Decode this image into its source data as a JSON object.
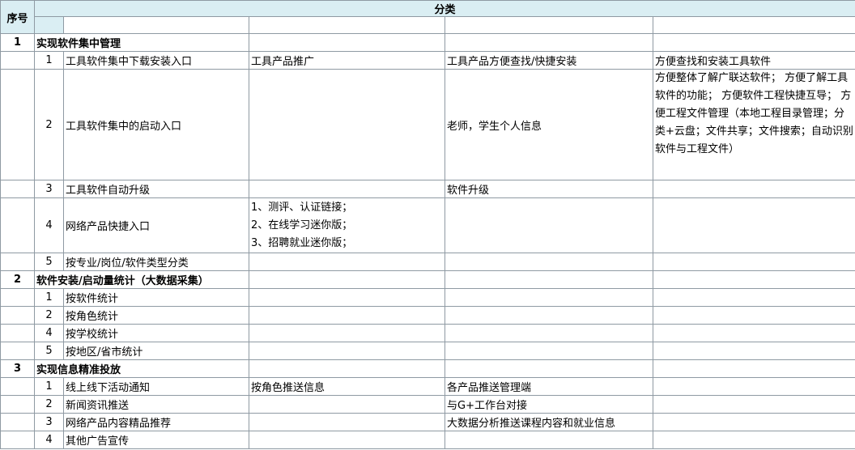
{
  "header": {
    "index_label": "序号",
    "category_label": "分类"
  },
  "sections": [
    {
      "number": "1",
      "title": "实现软件集中管理",
      "rows": [
        {
          "n": "1",
          "c1": "工具软件集中下载安装入口",
          "c2": "工具产品推广",
          "c3": "工具产品方便查找/快捷安装",
          "c4": "方便查找和安装工具软件"
        },
        {
          "n": "2",
          "c1": "工具软件集中的启动入口",
          "c2": "",
          "c3": "老师，学生个人信息",
          "c4": "方便整体了解广联达软件；\n方便了解工具软件的功能；\n方便软件工程快捷互导；\n方便工程文件管理（本地工程目录管理；分类+云盘；文件共享；文件搜索；自动识别软件与工程文件）"
        },
        {
          "n": "3",
          "c1": "工具软件自动升级",
          "c2": "",
          "c3": "软件升级",
          "c4": ""
        },
        {
          "n": "4",
          "c1": "网络产品快捷入口",
          "c2": "1、测评、认证链接；\n2、在线学习迷你版；\n3、招聘就业迷你版；",
          "c3": "",
          "c4": ""
        },
        {
          "n": "5",
          "c1": "按专业/岗位/软件类型分类",
          "c2": "",
          "c3": "",
          "c4": ""
        }
      ]
    },
    {
      "number": "2",
      "title": "软件安装/启动量统计（大数据采集）",
      "rows": [
        {
          "n": "1",
          "c1": "按软件统计",
          "c2": "",
          "c3": "",
          "c4": ""
        },
        {
          "n": "2",
          "c1": "按角色统计",
          "c2": "",
          "c3": "",
          "c4": ""
        },
        {
          "n": "4",
          "c1": "按学校统计",
          "c2": "",
          "c3": "",
          "c4": ""
        },
        {
          "n": "5",
          "c1": "按地区/省市统计",
          "c2": "",
          "c3": "",
          "c4": ""
        }
      ]
    },
    {
      "number": "3",
      "title": "实现信息精准投放",
      "rows": [
        {
          "n": "1",
          "c1": "线上线下活动通知",
          "c2": "按角色推送信息",
          "c3": "各产品推送管理端",
          "c4": ""
        },
        {
          "n": "2",
          "c1": "新闻资讯推送",
          "c2": "",
          "c3": "与G+工作台对接",
          "c4": ""
        },
        {
          "n": "3",
          "c1": "网络产品内容精品推荐",
          "c2": "",
          "c3": "大数据分析推送课程内容和就业信息",
          "c4": ""
        },
        {
          "n": "4",
          "c1": "其他广告宣传",
          "c2": "",
          "c3": "",
          "c4": ""
        }
      ]
    }
  ]
}
